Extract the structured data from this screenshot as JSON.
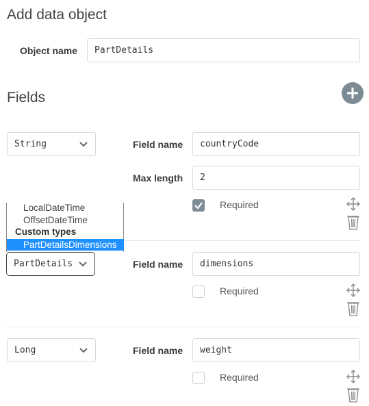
{
  "page": {
    "title": "Add data object"
  },
  "object": {
    "name_label": "Object name",
    "name_value": "PartDetails"
  },
  "fields_section": {
    "title": "Fields",
    "add_icon": "plus-icon"
  },
  "fields": [
    {
      "type": "String",
      "field_name_label": "Field name",
      "field_name_value": "countryCode",
      "max_length_label": "Max length",
      "max_length_value": "2",
      "required_label": "Required",
      "required": true
    },
    {
      "type": "PartDetails",
      "field_name_label": "Field name",
      "field_name_value": "dimensions",
      "required_label": "Required",
      "required": false
    },
    {
      "type": "Long",
      "field_name_label": "Field name",
      "field_name_value": "weight",
      "required_label": "Required",
      "required": false
    }
  ],
  "type_dropdown": {
    "options": [
      "LocalDateTime",
      "OffsetDateTime"
    ],
    "group_label": "Custom types",
    "selected_option": "PartDetailsDimensions"
  },
  "icons": {
    "move": "move-icon",
    "delete": "trash-icon",
    "chevron": "chevron-down-icon",
    "check": "checkmark-icon"
  },
  "colors": {
    "accent": "#7d8c94",
    "selected": "#1e90ff"
  }
}
